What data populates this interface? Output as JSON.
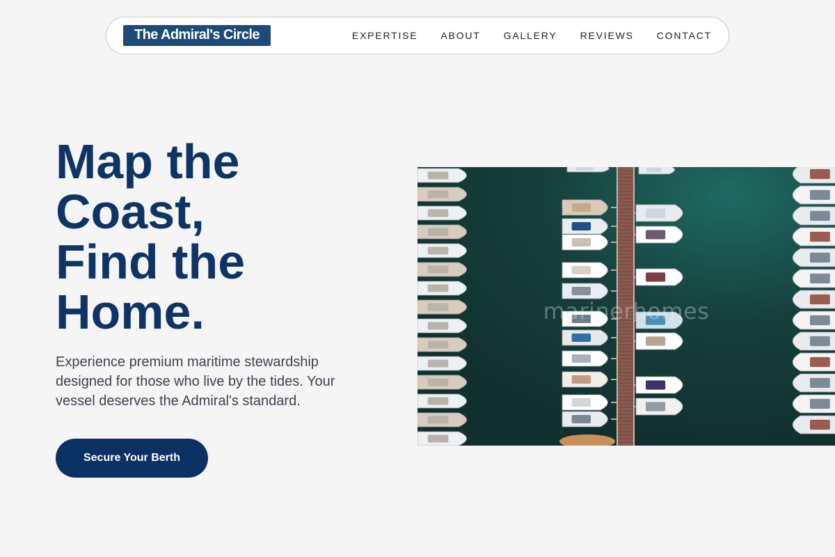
{
  "brand": {
    "name": "The Admiral's Circle"
  },
  "nav": {
    "links": [
      "EXPERTISE",
      "ABOUT",
      "GALLERY",
      "REVIEWS",
      "CONTACT"
    ]
  },
  "hero": {
    "title_lines": [
      "Map the",
      "Coast,",
      "Find the",
      "Home."
    ],
    "description": "Experience premium maritime stewardship designed for those who live by the tides. Your vessel deserves the Admiral's standard.",
    "cta_label": "Secure Your Berth"
  },
  "image": {
    "watermark": "marinerhomes",
    "subject": "aerial view of a marina with boats moored along wooden docks"
  },
  "colors": {
    "background": "#f5f5f5",
    "brand_blue": "#1e4a78",
    "title_navy": "#0d3464",
    "cta_navy": "#0b3163",
    "water": "#143a38"
  }
}
